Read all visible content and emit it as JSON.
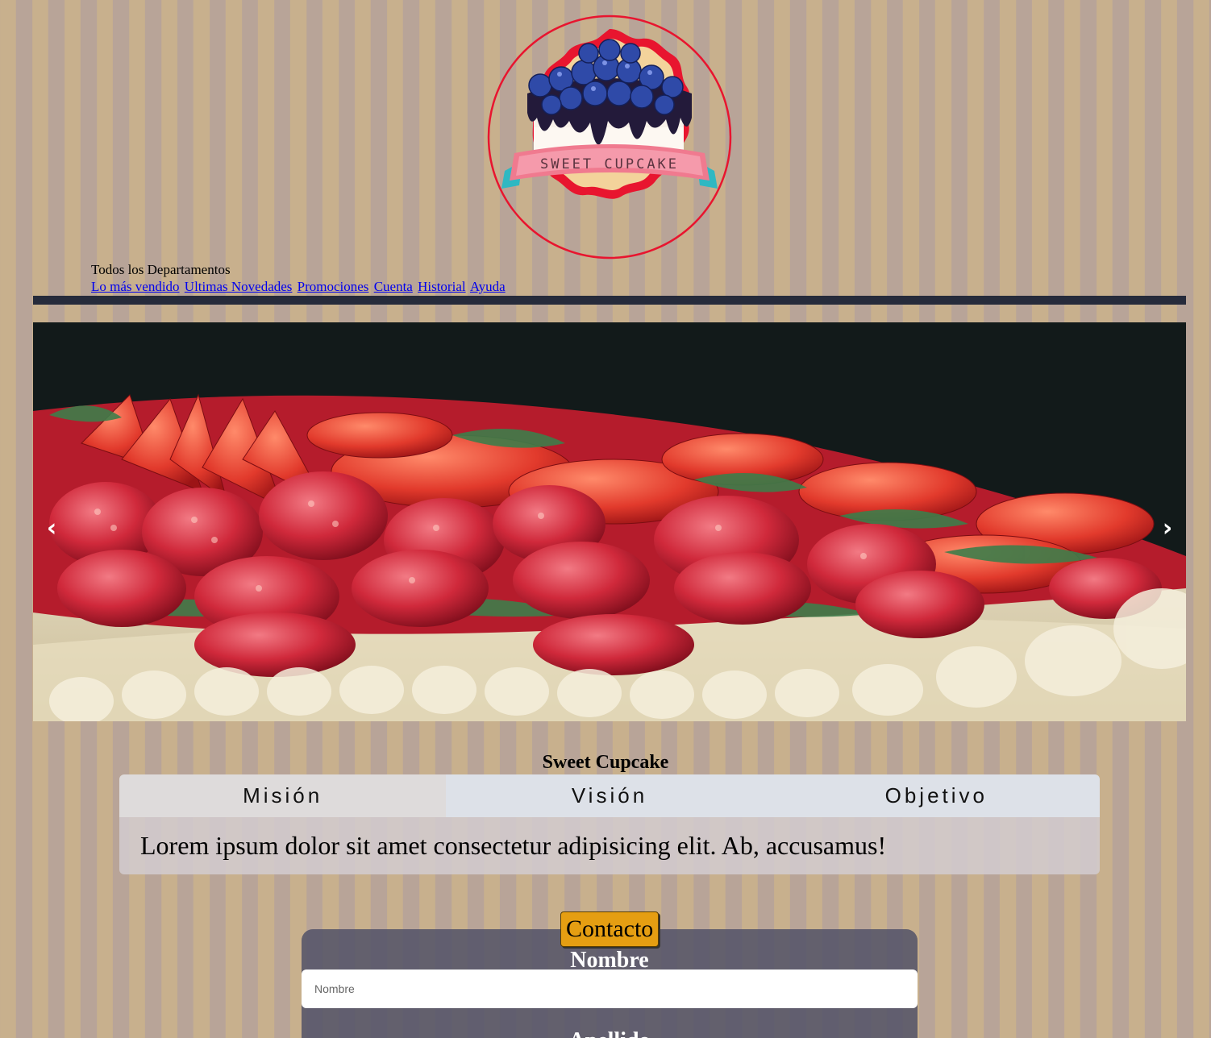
{
  "logo": {
    "text": "SWEET CUPCAKE",
    "colors": {
      "ring": "#e8152f",
      "ribbon": "#f07a8f",
      "berry": "#2f4aa8"
    }
  },
  "nav": {
    "departments_title": "Todos los Departamentos",
    "links": [
      "Lo más vendido",
      "Ultimas Novedades",
      "Promociones",
      "Cuenta",
      "Historial",
      "Ayuda"
    ]
  },
  "carousel": {
    "prev_icon": "‹",
    "next_icon": "›"
  },
  "about": {
    "title": "Sweet Cupcake",
    "tabs": [
      "Misión",
      "Visión",
      "Objetivo"
    ],
    "active_tab": "Misión",
    "content": "Lorem ipsum dolor sit amet consectetur adipisicing elit. Ab, accusamus!"
  },
  "contact": {
    "button_label": "Contacto",
    "nombre_label": "Nombre",
    "nombre_placeholder": "Nombre",
    "apellido_label": "Apellido"
  },
  "colors": {
    "stripe_a": "#c8b08d",
    "stripe_b": "#b8a498",
    "nav_bar": "#262b3b",
    "contact_accent": "#e59e12",
    "form_bg": "#545469"
  }
}
